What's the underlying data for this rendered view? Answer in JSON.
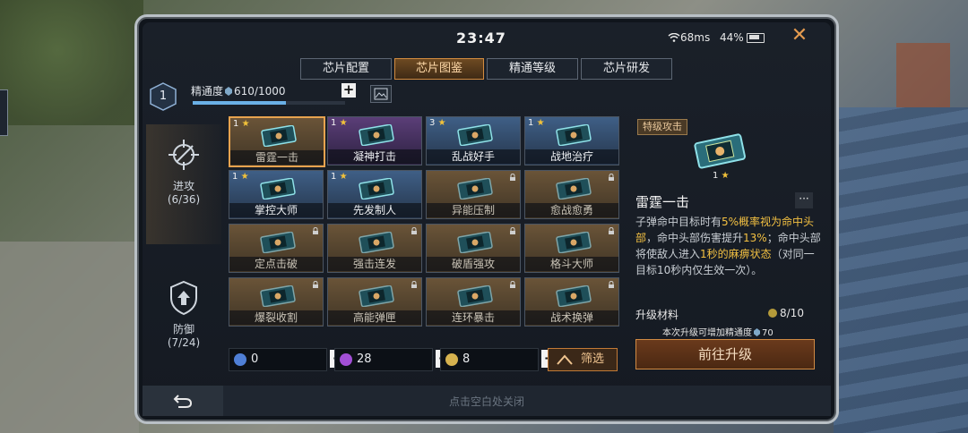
{
  "status": {
    "time": "23:47",
    "ping": "68ms",
    "battery": "44%"
  },
  "tabs": [
    {
      "label": "芯片配置"
    },
    {
      "label": "芯片图鉴"
    },
    {
      "label": "精通等级"
    },
    {
      "label": "芯片研发"
    }
  ],
  "mastery": {
    "level": "1",
    "label": "精通度",
    "value": "610/1000",
    "progress": 0.61
  },
  "nav": {
    "attack": {
      "label": "进攻",
      "count": "(6/36)"
    },
    "defense": {
      "label": "防御",
      "count": "(7/24)"
    }
  },
  "cards": [
    {
      "name": "雷霆一击",
      "level": "1",
      "stars": "★",
      "color": "gold",
      "locked": false,
      "selected": true
    },
    {
      "name": "凝神打击",
      "level": "1",
      "stars": "★",
      "color": "purple",
      "locked": false,
      "selected": false
    },
    {
      "name": "乱战好手",
      "level": "3",
      "stars": "★",
      "color": "blue",
      "locked": false,
      "selected": false
    },
    {
      "name": "战地治疗",
      "level": "1",
      "stars": "★",
      "color": "blue",
      "locked": false,
      "selected": false
    },
    {
      "name": "掌控大师",
      "level": "1",
      "stars": "★",
      "color": "blue",
      "locked": false,
      "selected": false
    },
    {
      "name": "先发制人",
      "level": "1",
      "stars": "★",
      "color": "blue",
      "locked": false,
      "selected": false
    },
    {
      "name": "异能压制",
      "level": "",
      "stars": "",
      "color": "gold",
      "locked": true,
      "selected": false
    },
    {
      "name": "愈战愈勇",
      "level": "",
      "stars": "",
      "color": "gold",
      "locked": true,
      "selected": false
    },
    {
      "name": "定点击破",
      "level": "",
      "stars": "",
      "color": "gold",
      "locked": true,
      "selected": false
    },
    {
      "name": "强击连发",
      "level": "",
      "stars": "",
      "color": "gold",
      "locked": true,
      "selected": false
    },
    {
      "name": "破盾强攻",
      "level": "",
      "stars": "",
      "color": "gold",
      "locked": true,
      "selected": false
    },
    {
      "name": "格斗大师",
      "level": "",
      "stars": "",
      "color": "gold",
      "locked": true,
      "selected": false
    },
    {
      "name": "爆裂收割",
      "level": "",
      "stars": "",
      "color": "gold",
      "locked": true,
      "selected": false
    },
    {
      "name": "高能弹匣",
      "level": "",
      "stars": "",
      "color": "gold",
      "locked": true,
      "selected": false
    },
    {
      "name": "连环暴击",
      "level": "",
      "stars": "",
      "color": "gold",
      "locked": true,
      "selected": false
    },
    {
      "name": "战术换弹",
      "level": "",
      "stars": "",
      "color": "gold",
      "locked": true,
      "selected": false
    }
  ],
  "resources": [
    {
      "value": "0",
      "color": "#4f7fd6"
    },
    {
      "value": "28",
      "color": "#a24fd6"
    },
    {
      "value": "8",
      "color": "#d6b24f"
    }
  ],
  "filter_label": "筛选",
  "detail": {
    "tag": "特级攻击",
    "level": "1",
    "name": "雷霆一击",
    "more": "···",
    "desc_1": "子弹命中目标时有",
    "desc_hl_1": "5%概率视为命中头部",
    "desc_2": "，命中头部伤害提升",
    "desc_hl_2": "13%",
    "desc_3": "；命中头部将使敌人进入",
    "desc_hl_3": "1秒的麻痹状态",
    "desc_4": "（对同一目标10秒内仅生效一次）。",
    "upgrade_label": "升级材料",
    "upgrade_count": "8/10",
    "upgrade_note": "本次升级可增加精通度",
    "upgrade_note_value": "70",
    "upgrade_button": "前往升级"
  },
  "footer_hint": "点击空白处关闭"
}
